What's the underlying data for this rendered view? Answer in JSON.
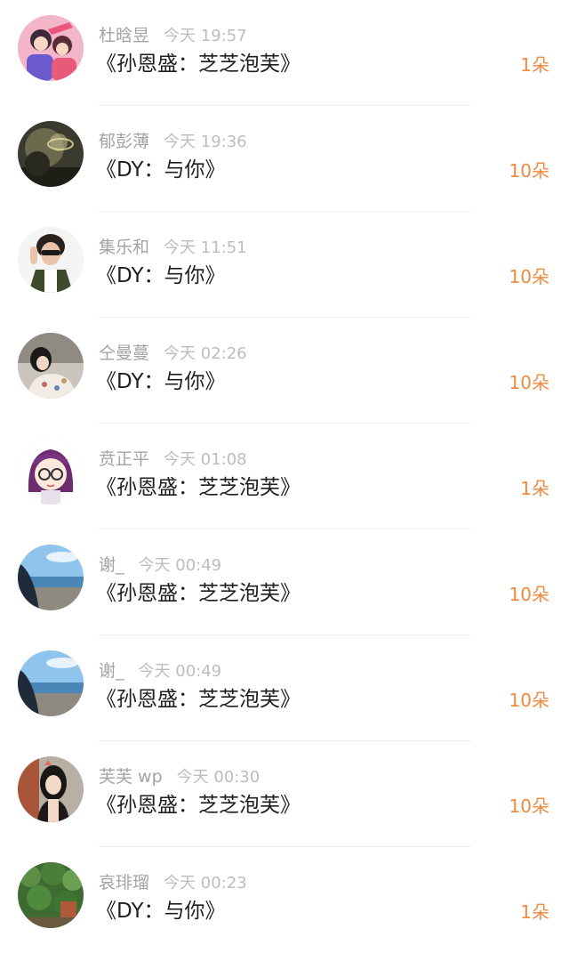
{
  "gifts": [
    {
      "name": "杜晗昱",
      "time": "今天 19:57",
      "song": "《孙恩盛：芝芝泡芙》",
      "count": "1朵",
      "avatar": "couple-illustration-avatar"
    },
    {
      "name": "郁彭薄",
      "time": "今天 19:36",
      "song": "《DY：与你》",
      "count": "10朵",
      "avatar": "dark-photo-avatar"
    },
    {
      "name": "集乐和",
      "time": "今天 11:51",
      "song": "《DY：与你》",
      "count": "10朵",
      "avatar": "man-sunglasses-avatar"
    },
    {
      "name": "仝曼蔓",
      "time": "今天 02:26",
      "song": "《DY：与你》",
      "count": "10朵",
      "avatar": "woman-lying-avatar"
    },
    {
      "name": "贲正平",
      "time": "今天 01:08",
      "song": "《孙恩盛：芝芝泡芙》",
      "count": "1朵",
      "avatar": "cartoon-girl-glasses-avatar"
    },
    {
      "name": "谢_",
      "time": "今天 00:49",
      "song": "《孙恩盛：芝芝泡芙》",
      "count": "10朵",
      "avatar": "seaside-avatar"
    },
    {
      "name": "谢_",
      "time": "今天 00:49",
      "song": "《孙恩盛：芝芝泡芙》",
      "count": "10朵",
      "avatar": "seaside-avatar"
    },
    {
      "name": "芙芙 wp",
      "time": "今天 00:30",
      "song": "《孙恩盛：芝芝泡芙》",
      "count": "10朵",
      "avatar": "girl-selfie-avatar"
    },
    {
      "name": "哀琲瑠",
      "time": "今天 00:23",
      "song": "《DY：与你》",
      "count": "1朵",
      "avatar": "green-garden-avatar"
    }
  ],
  "colors": {
    "accent": "#f08a3c",
    "title": "#1f1f1f",
    "muted": "#a3a3a3"
  }
}
